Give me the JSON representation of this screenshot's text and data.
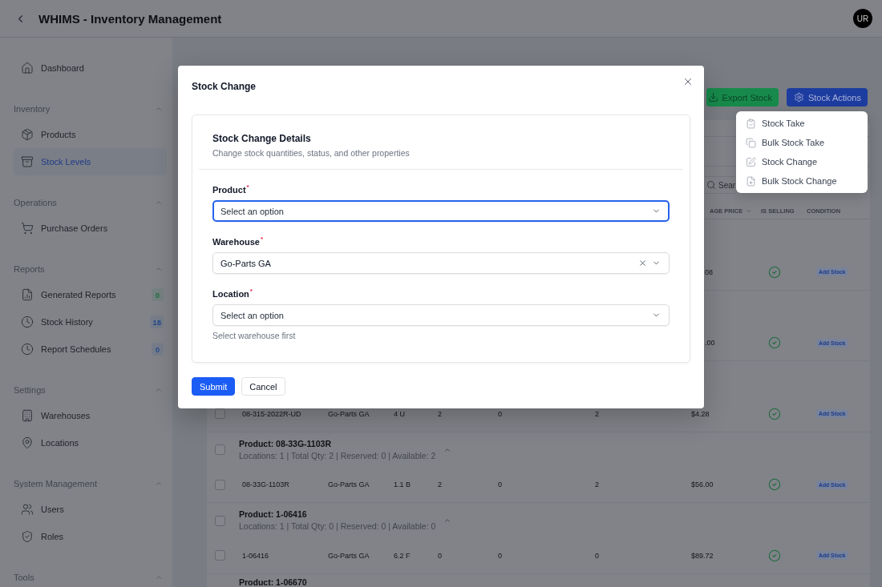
{
  "header": {
    "title": "WHIMS - Inventory Management",
    "avatar": "UR"
  },
  "sidebar": {
    "items": [
      {
        "label": "Dashboard",
        "selected": false
      }
    ],
    "sections": [
      {
        "title": "Inventory",
        "expanded": true,
        "items": [
          {
            "label": "Products",
            "selected": false
          },
          {
            "label": "Stock Levels",
            "selected": true
          }
        ]
      },
      {
        "title": "Operations",
        "expanded": true,
        "items": [
          {
            "label": "Purchase Orders",
            "selected": false
          }
        ]
      },
      {
        "title": "Reports",
        "expanded": true,
        "items": [
          {
            "label": "Generated Reports",
            "selected": false,
            "badge": {
              "text": "0",
              "color": "#1f6e3d"
            }
          },
          {
            "label": "Stock History",
            "selected": false,
            "badge": {
              "text": "18",
              "color": "#264a8c"
            }
          },
          {
            "label": "Report Schedules",
            "selected": false,
            "badge": {
              "text": "0",
              "color": "#264a8c"
            }
          }
        ]
      },
      {
        "title": "Settings",
        "expanded": true,
        "items": [
          {
            "label": "Warehouses",
            "selected": false
          },
          {
            "label": "Locations",
            "selected": false
          }
        ]
      },
      {
        "title": "System Management",
        "expanded": true,
        "items": [
          {
            "label": "Users",
            "selected": false
          },
          {
            "label": "Roles",
            "selected": false
          }
        ]
      },
      {
        "title": "Tools",
        "expanded": true
      }
    ]
  },
  "toolbar": {
    "actions": [
      {
        "label": "Export Stock",
        "kind": "export"
      },
      {
        "label": "Stock Actions",
        "kind": "menu"
      }
    ]
  },
  "stock_actions_menu": {
    "items": [
      {
        "label": "Stock Take"
      },
      {
        "label": "Bulk Stock Take"
      },
      {
        "label": "Stock Change"
      },
      {
        "label": "Bulk Stock Change"
      }
    ]
  },
  "search": {
    "placeholder": "Sear"
  },
  "table": {
    "columns": [
      {
        "label": "AGE PRICE",
        "sortable": true
      },
      {
        "label": "IS SELLING",
        "sortable": false
      },
      {
        "label": "CONDITION",
        "sortable": false
      }
    ],
    "rows": [
      {
        "kind": "clipped_item",
        "cells": [
          "08"
        ],
        "selling": true,
        "action": "Add Stock"
      },
      {
        "kind": "clipped_item",
        "cells": [
          ".00"
        ],
        "selling": true,
        "action": "Add Stock"
      },
      {
        "kind": "item",
        "checked": false,
        "cells": [
          "08-315-2022R-UD",
          "Go-Parts GA",
          "4 U",
          "2",
          "0",
          "2",
          "$4.28"
        ],
        "selling": true,
        "action": "Add Stock"
      },
      {
        "kind": "group",
        "checked": false,
        "title": "Product: 08-33G-1103R",
        "summary": "Locations: 1 | Total Qty: 2 | Reserved: 0 | Available: 2",
        "expanded": true
      },
      {
        "kind": "item",
        "checked": false,
        "cells": [
          "08-33G-1103R",
          "Go-Parts GA",
          "1.1 B",
          "2",
          "0",
          "2",
          "$56.00"
        ],
        "selling": true,
        "action": "Add Stock"
      },
      {
        "kind": "group",
        "checked": false,
        "title": "Product: 1-06416",
        "summary": "Locations: 1 | Total Qty: 0 | Reserved: 0 | Available: 0",
        "expanded": true
      },
      {
        "kind": "item",
        "checked": false,
        "cells": [
          "1-06416",
          "Go-Parts GA",
          "6.2 F",
          "0",
          "0",
          "0",
          "$89.72"
        ],
        "selling": true,
        "action": "Add Stock"
      },
      {
        "kind": "group",
        "title": "Product: 1-06670"
      }
    ]
  },
  "dialog": {
    "title": "Stock Change",
    "section": {
      "title": "Stock Change Details",
      "subtitle": "Change stock quantities, status, and other properties"
    },
    "fields": [
      {
        "label": "Product",
        "required_mark": "*",
        "placeholder": "Select an option",
        "focused": true
      },
      {
        "label": "Warehouse",
        "required_mark": "*",
        "value": "Go-Parts GA",
        "clearable": true,
        "focused": false
      },
      {
        "label": "Location",
        "required_mark": "*",
        "placeholder": "Select an option",
        "hint": "Select warehouse first",
        "focused": false
      }
    ],
    "buttons": [
      {
        "label": "Submit",
        "kind": "primary"
      },
      {
        "label": "Cancel",
        "kind": "secondary"
      }
    ]
  }
}
